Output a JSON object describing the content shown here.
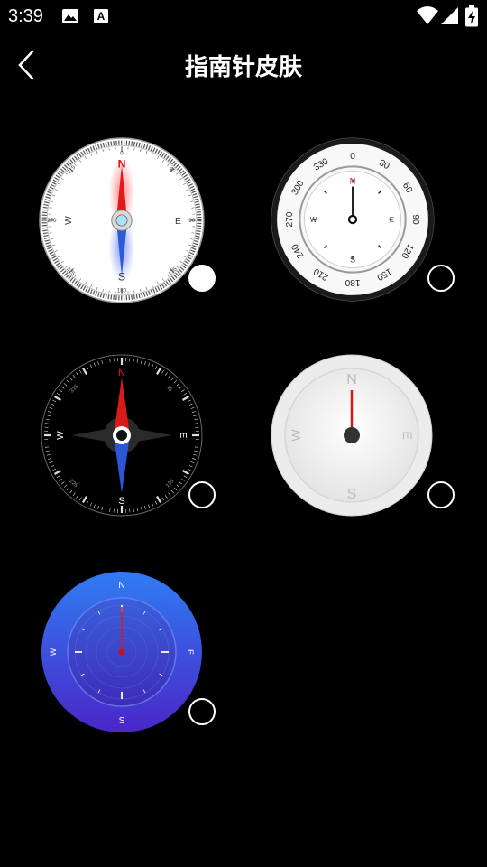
{
  "status_bar": {
    "time": "3:39",
    "notification_icons": [
      "image-icon",
      "font-icon"
    ],
    "system_icons": [
      "wifi-icon",
      "cell-signal-icon",
      "battery-charging-icon"
    ]
  },
  "app_bar": {
    "back_icon": "chevron-left-icon",
    "title": "指南针皮肤"
  },
  "skins": [
    {
      "id": 1,
      "style": "classic-white",
      "selected": true,
      "labels": {
        "n": "N",
        "e": "E",
        "s": "S",
        "w": "W",
        "deg_0": "0",
        "deg_45": "45",
        "deg_90": "90",
        "deg_135": "135",
        "deg_180": "180",
        "deg_225": "225",
        "deg_270": "270",
        "deg_315": "315"
      }
    },
    {
      "id": 2,
      "style": "silver-bezel",
      "selected": false,
      "labels": {
        "n": "N",
        "e": "E",
        "s": "S",
        "w": "W",
        "deg_0": "0",
        "deg_30": "30",
        "deg_60": "60",
        "deg_90": "90",
        "deg_120": "120",
        "deg_150": "150",
        "deg_180": "180",
        "deg_210": "210",
        "deg_240": "240",
        "deg_270": "270",
        "deg_300": "300",
        "deg_330": "330"
      }
    },
    {
      "id": 3,
      "style": "dark-needle",
      "selected": false,
      "labels": {
        "n": "N",
        "e": "E",
        "s": "S",
        "w": "W",
        "deg_45": "45",
        "deg_135": "135",
        "deg_225": "225",
        "deg_315": "315"
      }
    },
    {
      "id": 4,
      "style": "minimal-white",
      "selected": false,
      "labels": {
        "n": "N",
        "e": "E",
        "s": "S",
        "w": "W"
      }
    },
    {
      "id": 5,
      "style": "blue-gradient",
      "selected": false,
      "labels": {
        "n": "N",
        "e": "E",
        "s": "S",
        "w": "W"
      }
    }
  ],
  "colors": {
    "background": "#000000",
    "needle_red": "#e01919",
    "needle_blue": "#2a5bd7",
    "blue_dial_top": "#2f7cf2",
    "blue_dial_bottom": "#4a26c8"
  }
}
